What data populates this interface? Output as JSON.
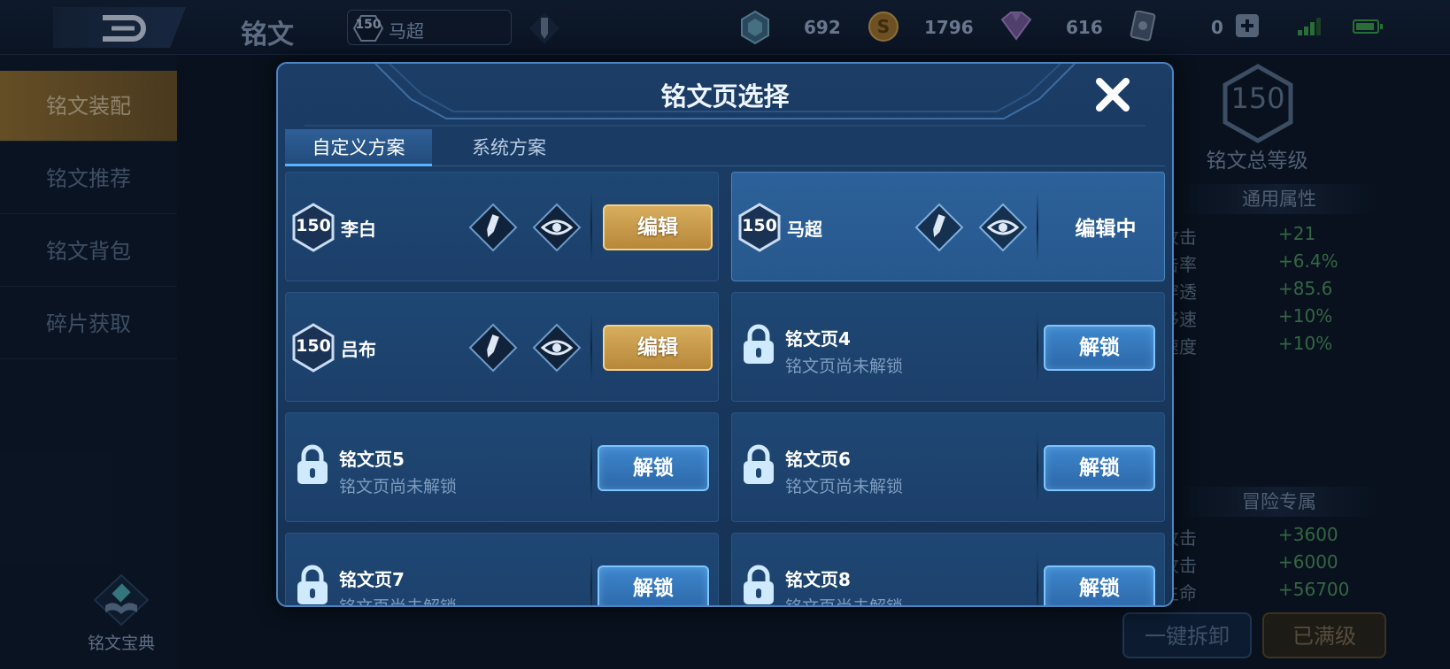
{
  "topbar": {
    "title": "铭文",
    "hero_level": "150",
    "hero_name": "马超",
    "resources": [
      {
        "icon": "crystal-shield-icon",
        "value": "692"
      },
      {
        "icon": "gold-coin-icon",
        "value": "1796"
      },
      {
        "icon": "purple-gem-icon",
        "value": "616"
      },
      {
        "icon": "card-icon",
        "value": "0"
      }
    ]
  },
  "sidebar": {
    "items": [
      {
        "label": "铭文装配",
        "active": true
      },
      {
        "label": "铭文推荐",
        "active": false
      },
      {
        "label": "铭文背包",
        "active": false
      },
      {
        "label": "碎片获取",
        "active": false
      }
    ],
    "codex_label": "铭文宝典"
  },
  "right_panel": {
    "total_level": "150",
    "total_label": "铭文总等级",
    "general_header": "通用属性",
    "general_stats": [
      {
        "name": "物理攻击",
        "value": "+21"
      },
      {
        "name": "暴击率",
        "value": "+6.4%"
      },
      {
        "name": "物理穿透",
        "value": "+85.6"
      },
      {
        "name": "移速",
        "value": "+10%"
      },
      {
        "name": "攻击速度",
        "value": "+10%"
      }
    ],
    "adventure_header": "冒险专属",
    "adventure_stats": [
      {
        "name": "物理攻击",
        "value": "+3600"
      },
      {
        "name": "法术攻击",
        "value": "+6000"
      },
      {
        "name": "最大生命",
        "value": "+56700"
      }
    ],
    "dismantle_label": "一键拆卸",
    "maxed_label": "已满级"
  },
  "modal": {
    "title": "铭文页选择",
    "tabs": [
      {
        "label": "自定义方案",
        "active": true
      },
      {
        "label": "系统方案",
        "active": false
      }
    ],
    "edit_label": "编辑",
    "editing_label": "编辑中",
    "unlock_label": "解锁",
    "locked_sub": "铭文页尚未解锁",
    "pages": [
      {
        "level": "150",
        "name": "李白"
      },
      {
        "level": "150",
        "name": "马超"
      },
      {
        "level": "150",
        "name": "吕布"
      }
    ],
    "locked_pages": [
      {
        "name": "铭文页4"
      },
      {
        "name": "铭文页5"
      },
      {
        "name": "铭文页6"
      },
      {
        "name": "铭文页7"
      },
      {
        "name": "铭文页8"
      }
    ]
  },
  "colors": {
    "edit_gold": "#d7ad5d",
    "unlock_blue": "#3e86cc",
    "modal_bg": "#1b3d66",
    "stat_green": "#4f9a5e"
  }
}
